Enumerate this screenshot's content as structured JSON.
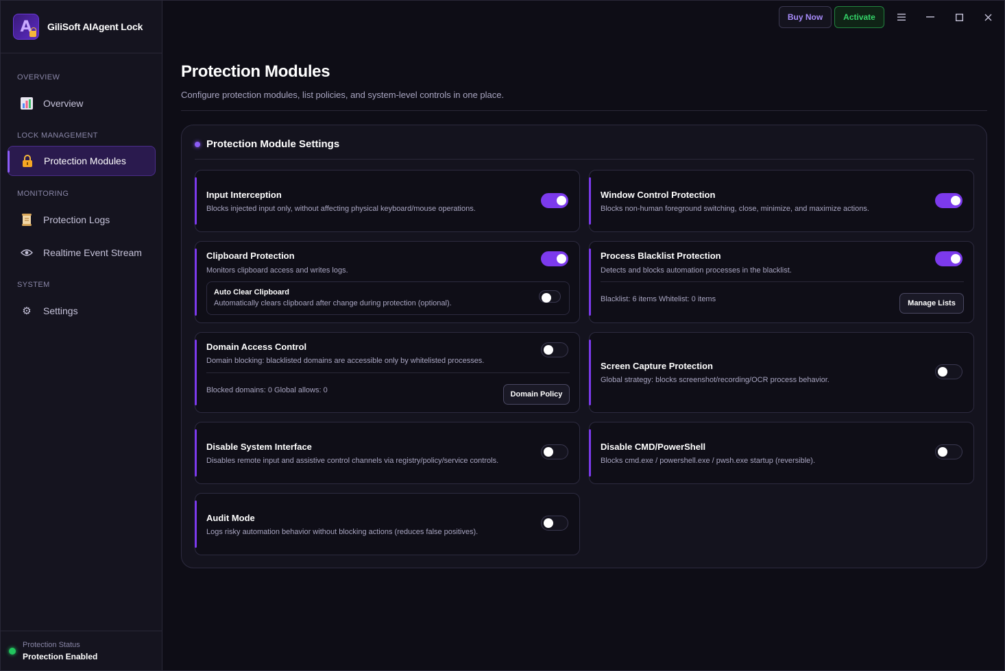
{
  "app": {
    "name": "GiliSoft AIAgent Lock"
  },
  "top_bar": {
    "buy_label": "Buy Now",
    "activate_label": "Activate"
  },
  "sidebar": {
    "sections": [
      {
        "label": "OVERVIEW"
      },
      {
        "label": "LOCK MANAGEMENT"
      },
      {
        "label": "MONITORING"
      },
      {
        "label": "SYSTEM"
      }
    ],
    "items": [
      {
        "label": "Overview",
        "icon": "bar-chart-icon"
      },
      {
        "label": "Protection Modules",
        "icon": "lock-icon",
        "active": true
      },
      {
        "label": "Protection Logs",
        "icon": "scroll-icon"
      },
      {
        "label": "Realtime Event Stream",
        "icon": "eye-icon"
      },
      {
        "label": "Settings",
        "icon": "gear-icon"
      }
    ],
    "status": {
      "label": "Protection Status",
      "value": "Protection Enabled",
      "color": "#22c55e"
    }
  },
  "main": {
    "title": "Protection Modules",
    "subtitle": "Configure protection modules, list policies, and system-level controls in one place.",
    "panel_title": "Protection Module Settings",
    "modules": [
      {
        "title": "Input Interception",
        "desc": "Blocks injected input only, without affecting physical keyboard/mouse operations.",
        "enabled": true
      },
      {
        "title": "Window Control Protection",
        "desc": "Blocks non-human foreground switching, close, minimize, and maximize actions.",
        "enabled": true
      },
      {
        "title": "Clipboard Protection",
        "desc": "Monitors clipboard access and writes logs.",
        "enabled": true,
        "sub": {
          "title": "Auto Clear Clipboard",
          "desc": "Automatically clears clipboard after change during protection (optional).",
          "enabled": false
        }
      },
      {
        "title": "Process Blacklist Protection",
        "desc": "Detects and blocks automation processes in the blacklist.",
        "enabled": true,
        "meta": "Blacklist: 6 items Whitelist: 0 items",
        "button": "Manage Lists"
      },
      {
        "title": "Domain Access Control",
        "desc": "Domain blocking: blacklisted domains are accessible only by whitelisted processes.",
        "enabled": false,
        "meta": "Blocked domains: 0 Global allows: 0",
        "button": "Domain Policy"
      },
      {
        "title": "Screen Capture Protection",
        "desc": "Global strategy: blocks screenshot/recording/OCR process behavior.",
        "enabled": false
      },
      {
        "title": "Disable System Interface",
        "desc": "Disables remote input and assistive control channels via registry/policy/service controls.",
        "enabled": false
      },
      {
        "title": "Disable CMD/PowerShell",
        "desc": "Blocks cmd.exe / powershell.exe / pwsh.exe startup (reversible).",
        "enabled": false
      },
      {
        "title": "Audit Mode",
        "desc": "Logs risky automation behavior without blocking actions (reduces false positives).",
        "enabled": false
      }
    ]
  },
  "colors": {
    "accent": "#7c3aed",
    "success": "#22c55e",
    "background": "#0e0d16"
  }
}
